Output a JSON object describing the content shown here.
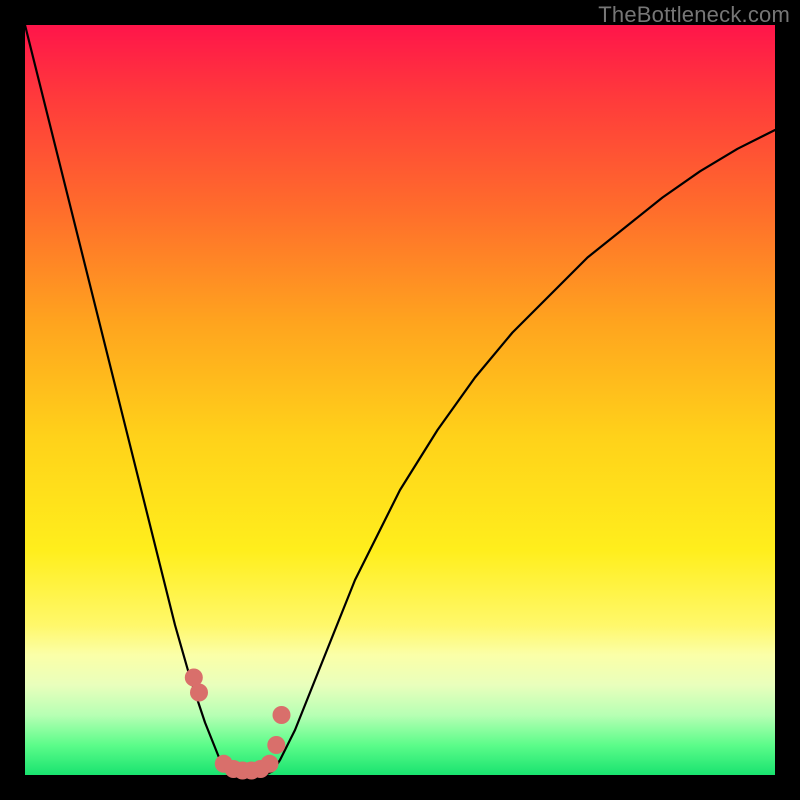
{
  "watermark": "TheBottleneck.com",
  "chart_data": {
    "type": "line",
    "title": "",
    "xlabel": "",
    "ylabel": "",
    "xlim": [
      0,
      100
    ],
    "ylim": [
      0,
      100
    ],
    "x": [
      0,
      2,
      4,
      6,
      8,
      10,
      12,
      14,
      16,
      18,
      20,
      22,
      24,
      26,
      27,
      28,
      29,
      30,
      31,
      32,
      33,
      34,
      36,
      38,
      40,
      42,
      44,
      46,
      48,
      50,
      55,
      60,
      65,
      70,
      75,
      80,
      85,
      90,
      95,
      100
    ],
    "values": [
      100,
      92,
      84,
      76,
      68,
      60,
      52,
      44,
      36,
      28,
      20,
      13,
      7,
      2,
      0.5,
      0,
      0,
      0,
      0,
      0,
      0.5,
      2,
      6,
      11,
      16,
      21,
      26,
      30,
      34,
      38,
      46,
      53,
      59,
      64,
      69,
      73,
      77,
      80.5,
      83.5,
      86
    ],
    "markers": {
      "x": [
        22.5,
        23.2,
        26.5,
        27.8,
        29.0,
        30.2,
        31.4,
        32.6,
        33.5,
        34.2
      ],
      "y": [
        13,
        11,
        1.5,
        0.8,
        0.6,
        0.6,
        0.8,
        1.5,
        4,
        8
      ]
    },
    "notes": "V-shaped bottleneck curve. Minimum (ideal match) around x≈28-30 where y≈0. Left branch is steeper than right branch. Salmon/pink markers cluster near the trough and slightly up each side."
  }
}
